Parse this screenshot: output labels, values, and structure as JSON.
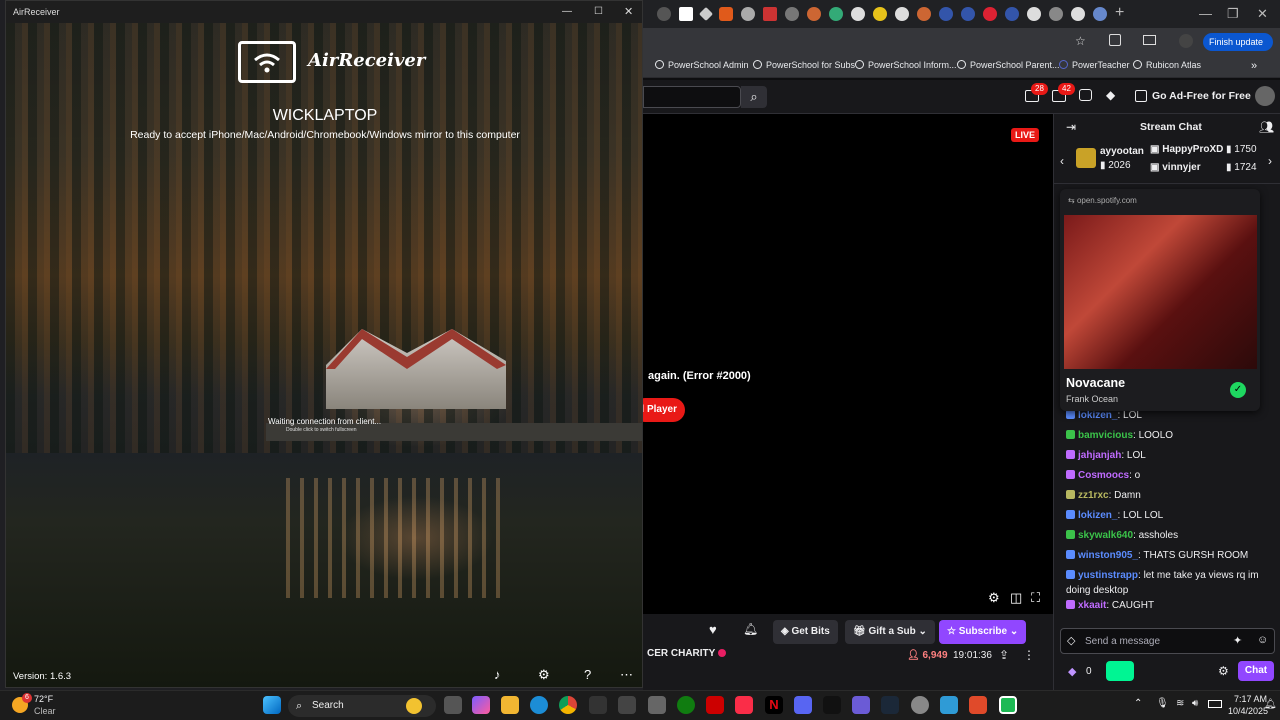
{
  "browser": {
    "finish_update": "Finish update",
    "bookmarks": [
      "PowerSchool Admin",
      "PowerSchool for Subs",
      "PowerSchool Inform...",
      "PowerSchool Parent...",
      "PowerTeacher",
      "Rubicon Atlas"
    ],
    "notif_count_1": "28",
    "notif_count_2": "42",
    "ad_free": "Go Ad-Free for Free"
  },
  "player": {
    "live": "LIVE",
    "error": "again. (Error #2000)",
    "error_button": "l Player"
  },
  "info": {
    "get_bits": "Get Bits",
    "gift_sub": "Gift a Sub",
    "subscribe": "Subscribe",
    "title_fragment": "CER CHARITY",
    "viewers": "6,949",
    "uptime": "19:01:36"
  },
  "chat": {
    "title": "Stream Chat",
    "leader1_name": "ayyootan",
    "leader1_score": "2026",
    "leader2_name": "HappyProXD",
    "leader2_score": "1750",
    "leader3_name": "vinnyjer",
    "leader3_score": "1724",
    "messages": [
      {
        "user": "lokizen_",
        "text": ": LOL",
        "color": "#5b8cff"
      },
      {
        "user": "bamvicious",
        "text": ": LOOLO",
        "color": "#3bc34a"
      },
      {
        "user": "jahjanjah",
        "text": ": LOL",
        "color": "#bf6bff"
      },
      {
        "user": "Cosmoocs",
        "text": ": o",
        "color": "#bf6bff"
      },
      {
        "user": "zz1rxc",
        "text": ": Damn",
        "color": "#b8b860"
      },
      {
        "user": "lokizen_",
        "text": ": LOL LOL",
        "color": "#5b8cff"
      },
      {
        "user": "skywalk640",
        "text": ": assholes",
        "color": "#3bc34a"
      },
      {
        "user": "winston905_",
        "text": ": THATS GURSH ROOM",
        "color": "#5b8cff"
      },
      {
        "user": "yustinstrapp",
        "text": ": let me take ya views rq im",
        "color": "#5b8cff"
      },
      {
        "user": "",
        "text": "doing desktop",
        "color": "#efeff1"
      },
      {
        "user": "xkaait",
        "text": ": CAUGHT",
        "color": "#bf6bff"
      }
    ],
    "send_placeholder": "Send a message",
    "points": "0",
    "chat_button": "Chat"
  },
  "spotify": {
    "domain": "open.spotify.com",
    "track": "Novacane",
    "artist": "Frank Ocean"
  },
  "airreceiver": {
    "window_title": "AirReceiver",
    "app_name": "AirReceiver",
    "hostname": "WICKLAPTOP",
    "ready_text": "Ready to accept iPhone/Mac/Android/Chromebook/Windows mirror to this computer",
    "waiting": "Waiting connection from client...",
    "double_click": "Double click to switch fullscreen",
    "version": "Version: 1.6.3"
  },
  "taskbar": {
    "weather_temp": "72°F",
    "weather_cond": "Clear",
    "weather_badge": "6",
    "search": "Search",
    "time": "7:17 AM",
    "date": "10/4/2025"
  }
}
